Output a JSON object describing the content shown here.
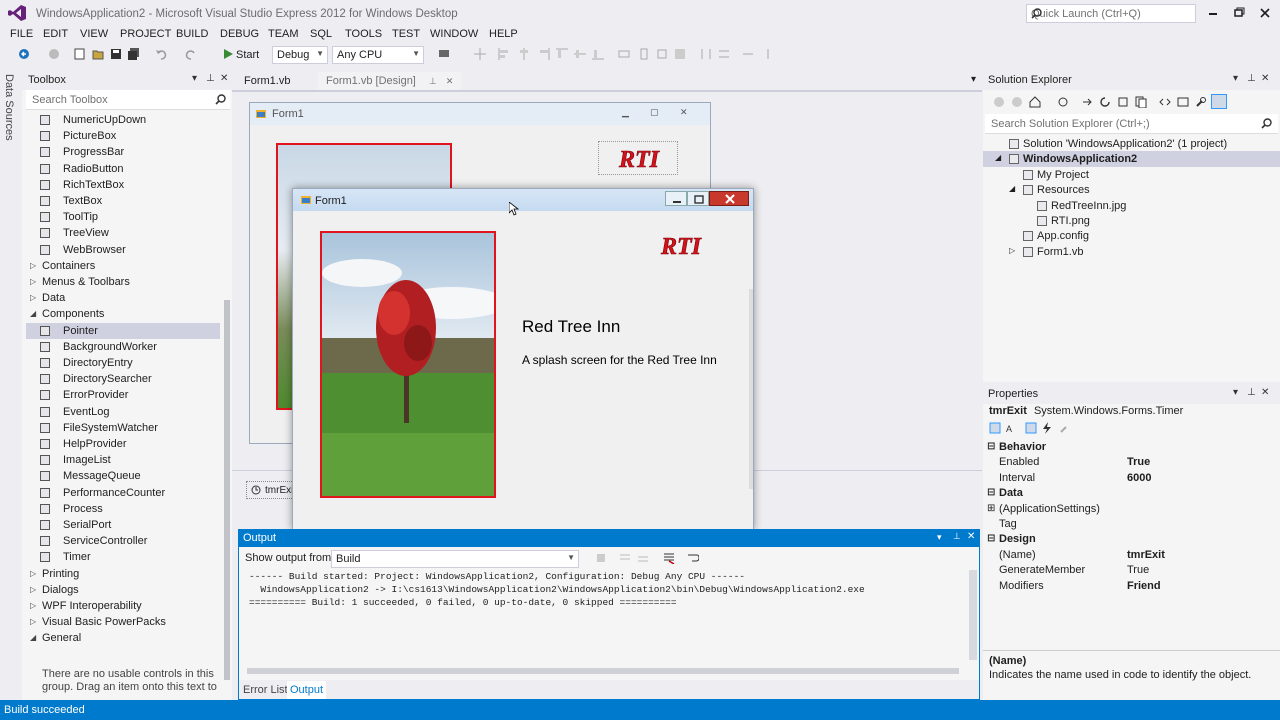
{
  "window": {
    "title": "WindowsApplication2 - Microsoft Visual Studio Express 2012 for Windows Desktop",
    "quick_launch_placeholder": "Quick Launch (Ctrl+Q)"
  },
  "menu": [
    "FILE",
    "EDIT",
    "VIEW",
    "PROJECT",
    "BUILD",
    "DEBUG",
    "TEAM",
    "SQL",
    "TOOLS",
    "TEST",
    "WINDOW",
    "HELP"
  ],
  "toolbar": {
    "start_label": "Start",
    "config": "Debug",
    "platform": "Any CPU"
  },
  "datasources_label": "Data Sources",
  "toolbox": {
    "title": "Toolbox",
    "search_placeholder": "Search Toolbox",
    "items": [
      {
        "label": "NumericUpDown",
        "kind": "item",
        "icon": "numeric-updown-icon"
      },
      {
        "label": "PictureBox",
        "kind": "item",
        "icon": "picturebox-icon"
      },
      {
        "label": "ProgressBar",
        "kind": "item",
        "icon": "progressbar-icon"
      },
      {
        "label": "RadioButton",
        "kind": "item",
        "icon": "radiobutton-icon"
      },
      {
        "label": "RichTextBox",
        "kind": "item",
        "icon": "richtextbox-icon"
      },
      {
        "label": "TextBox",
        "kind": "item",
        "icon": "textbox-icon"
      },
      {
        "label": "ToolTip",
        "kind": "item",
        "icon": "tooltip-icon"
      },
      {
        "label": "TreeView",
        "kind": "item",
        "icon": "treeview-icon"
      },
      {
        "label": "WebBrowser",
        "kind": "item",
        "icon": "webbrowser-icon"
      },
      {
        "label": "Containers",
        "kind": "cat",
        "open": false
      },
      {
        "label": "Menus & Toolbars",
        "kind": "cat",
        "open": false
      },
      {
        "label": "Data",
        "kind": "cat",
        "open": false
      },
      {
        "label": "Components",
        "kind": "cat",
        "open": true
      },
      {
        "label": "Pointer",
        "kind": "item",
        "icon": "pointer-icon",
        "selected": true
      },
      {
        "label": "BackgroundWorker",
        "kind": "item",
        "icon": "backgroundworker-icon"
      },
      {
        "label": "DirectoryEntry",
        "kind": "item",
        "icon": "directoryentry-icon"
      },
      {
        "label": "DirectorySearcher",
        "kind": "item",
        "icon": "directorysearcher-icon"
      },
      {
        "label": "ErrorProvider",
        "kind": "item",
        "icon": "errorprovider-icon"
      },
      {
        "label": "EventLog",
        "kind": "item",
        "icon": "eventlog-icon"
      },
      {
        "label": "FileSystemWatcher",
        "kind": "item",
        "icon": "filesystemwatcher-icon"
      },
      {
        "label": "HelpProvider",
        "kind": "item",
        "icon": "helpprovider-icon"
      },
      {
        "label": "ImageList",
        "kind": "item",
        "icon": "imagelist-icon"
      },
      {
        "label": "MessageQueue",
        "kind": "item",
        "icon": "messagequeue-icon"
      },
      {
        "label": "PerformanceCounter",
        "kind": "item",
        "icon": "performancecounter-icon"
      },
      {
        "label": "Process",
        "kind": "item",
        "icon": "process-icon"
      },
      {
        "label": "SerialPort",
        "kind": "item",
        "icon": "serialport-icon"
      },
      {
        "label": "ServiceController",
        "kind": "item",
        "icon": "servicecontroller-icon"
      },
      {
        "label": "Timer",
        "kind": "item",
        "icon": "timer-icon"
      },
      {
        "label": "Printing",
        "kind": "cat",
        "open": false
      },
      {
        "label": "Dialogs",
        "kind": "cat",
        "open": false
      },
      {
        "label": "WPF Interoperability",
        "kind": "cat",
        "open": false
      },
      {
        "label": "Visual Basic PowerPacks",
        "kind": "cat",
        "open": false
      },
      {
        "label": "General",
        "kind": "cat",
        "open": true
      }
    ],
    "empty_message_1": "There are no usable controls in this",
    "empty_message_2": "group. Drag an item onto this text to"
  },
  "tabs": [
    {
      "label": "Form1.vb"
    },
    {
      "label": "Form1.vb [Design]"
    }
  ],
  "designer": {
    "form_title": "Form1",
    "component_tray_item": "tmrExit"
  },
  "running_form": {
    "title": "Form1",
    "logo": "RTI",
    "heading": "Red Tree Inn",
    "subtitle": "A splash screen for the Red Tree Inn"
  },
  "output": {
    "title": "Output",
    "show_from_label": "Show output from:",
    "source": "Build",
    "lines": [
      "------ Build started: Project: WindowsApplication2, Configuration: Debug Any CPU ------",
      "  WindowsApplication2 -> I:\\cs1613\\WindowsApplication2\\WindowsApplication2\\bin\\Debug\\WindowsApplication2.exe",
      "========== Build: 1 succeeded, 0 failed, 0 up-to-date, 0 skipped =========="
    ],
    "bottom_tabs": [
      "Error List",
      "Output"
    ]
  },
  "solution_explorer": {
    "title": "Solution Explorer",
    "search_placeholder": "Search Solution Explorer (Ctrl+;)",
    "nodes": [
      {
        "label": "Solution 'WindowsApplication2' (1 project)",
        "level": 0,
        "icon": "solution-icon"
      },
      {
        "label": "WindowsApplication2",
        "level": 0,
        "icon": "vb-project-icon",
        "bold": true,
        "expander": "open"
      },
      {
        "label": "My Project",
        "level": 1,
        "icon": "wrench-icon"
      },
      {
        "label": "Resources",
        "level": 1,
        "icon": "folder-icon",
        "expander": "open"
      },
      {
        "label": "RedTreeInn.jpg",
        "level": 2,
        "icon": "image-file-icon"
      },
      {
        "label": "RTI.png",
        "level": 2,
        "icon": "image-file-icon"
      },
      {
        "label": "App.config",
        "level": 1,
        "icon": "config-file-icon"
      },
      {
        "label": "Form1.vb",
        "level": 1,
        "icon": "form-file-icon",
        "expander": "closed"
      }
    ]
  },
  "properties": {
    "title": "Properties",
    "object_name": "tmrExit",
    "object_type": "System.Windows.Forms.Timer",
    "rows": [
      {
        "kind": "cat",
        "name": "Behavior"
      },
      {
        "kind": "prop",
        "name": "Enabled",
        "value": "True",
        "bold": true
      },
      {
        "kind": "prop",
        "name": "Interval",
        "value": "6000",
        "bold": true
      },
      {
        "kind": "cat",
        "name": "Data"
      },
      {
        "kind": "prop",
        "name": "(ApplicationSettings)",
        "value": "",
        "expander": true
      },
      {
        "kind": "prop",
        "name": "Tag",
        "value": ""
      },
      {
        "kind": "cat",
        "name": "Design"
      },
      {
        "kind": "prop",
        "name": "(Name)",
        "value": "tmrExit",
        "bold": true
      },
      {
        "kind": "prop",
        "name": "GenerateMember",
        "value": "True",
        "bold": false
      },
      {
        "kind": "prop",
        "name": "Modifiers",
        "value": "Friend",
        "bold": true
      }
    ],
    "desc_title": "(Name)",
    "desc_text": "Indicates the name used in code to identify the object."
  },
  "status": {
    "text": "Build succeeded"
  },
  "colors": {
    "accent": "#007acc",
    "rti_red": "#d4121b",
    "bg": "#eeeef2"
  }
}
